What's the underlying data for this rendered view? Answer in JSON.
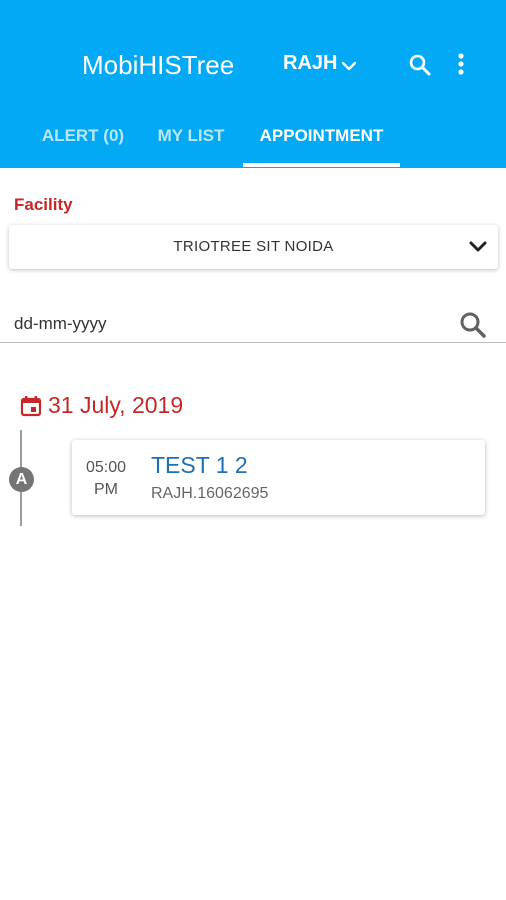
{
  "app": {
    "title": "MobiHISTree"
  },
  "account": {
    "label": "RAJH"
  },
  "tabs": [
    {
      "label": "ALERT (0)"
    },
    {
      "label": "MY LIST"
    },
    {
      "label": "APPOINTMENT"
    }
  ],
  "active_tab": "APPOINTMENT",
  "facility": {
    "label": "Facility",
    "value": "TRIOTREE SIT NOIDA"
  },
  "date_filter": {
    "placeholder": "dd-mm-yyyy",
    "value": ""
  },
  "schedule": {
    "date": "31 July, 2019",
    "appointments": [
      {
        "badge": "A",
        "time": "05:00",
        "period": "PM",
        "name": "TEST 1 2",
        "id": "RAJH.16062695"
      }
    ]
  },
  "colors": {
    "appbar": "#03a9f4",
    "accent_red": "#c62828",
    "name_blue": "#1e6fb5"
  },
  "icons": {
    "search": "search-icon",
    "more": "more-vert-icon",
    "account_dropdown": "chevron-down-icon",
    "facility_dropdown": "chevron-down-icon",
    "date_search": "search-icon",
    "date_header": "calendar-icon"
  }
}
